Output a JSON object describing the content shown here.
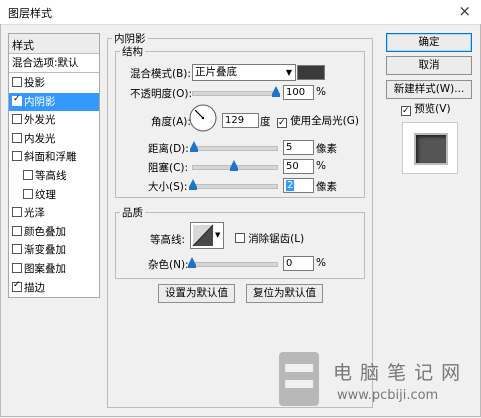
{
  "window": {
    "title": "图层样式",
    "close_glyph": "×"
  },
  "left_panel": {
    "header": "样式",
    "default_item": "混合选项:默认",
    "items": [
      {
        "label": "投影",
        "checked": false,
        "selected": false,
        "indent": false
      },
      {
        "label": "内阴影",
        "checked": true,
        "selected": true,
        "indent": false
      },
      {
        "label": "外发光",
        "checked": false,
        "selected": false,
        "indent": false
      },
      {
        "label": "内发光",
        "checked": false,
        "selected": false,
        "indent": false
      },
      {
        "label": "斜面和浮雕",
        "checked": false,
        "selected": false,
        "indent": false
      },
      {
        "label": "等高线",
        "checked": false,
        "selected": false,
        "indent": true
      },
      {
        "label": "纹理",
        "checked": false,
        "selected": false,
        "indent": true
      },
      {
        "label": "光泽",
        "checked": false,
        "selected": false,
        "indent": false
      },
      {
        "label": "颜色叠加",
        "checked": false,
        "selected": false,
        "indent": false
      },
      {
        "label": "渐变叠加",
        "checked": false,
        "selected": false,
        "indent": false
      },
      {
        "label": "图案叠加",
        "checked": false,
        "selected": false,
        "indent": false
      },
      {
        "label": "描边",
        "checked": true,
        "selected": false,
        "indent": false
      }
    ]
  },
  "inner_shadow": {
    "group_title": "内阴影",
    "structure": {
      "title": "结构",
      "blend_mode_label": "混合模式(B):",
      "blend_mode_value": "正片叠底",
      "opacity_label": "不透明度(O):",
      "opacity_value": "100",
      "opacity_level": 1.0,
      "percent": "%",
      "angle_label": "角度(A):",
      "angle_value": "129",
      "degree_unit": "度",
      "global_light_label": "使用全局光(G)",
      "global_light_checked": true,
      "distance_label": "距离(D):",
      "distance_value": "5",
      "distance_level": 0.02,
      "choke_label": "阻塞(C):",
      "choke_value": "50",
      "choke_level": 0.5,
      "size_label": "大小(S):",
      "size_value": "2",
      "size_level": 0.01,
      "pixel_unit": "像素",
      "shadow_color": "#3a3a3a"
    },
    "quality": {
      "title": "品质",
      "contour_label": "等高线:",
      "antialias_label": "消除锯齿(L)",
      "antialias_checked": false,
      "noise_label": "杂色(N):",
      "noise_value": "0",
      "noise_level": 0.0,
      "percent": "%"
    },
    "buttons": {
      "set_default": "设置为默认值",
      "reset_default": "复位为默认值"
    }
  },
  "right_panel": {
    "ok": "确定",
    "cancel": "取消",
    "new_style": "新建样式(W)...",
    "preview_label": "预览(V)",
    "preview_checked": true
  },
  "watermark": {
    "text_cn": "电 脑 笔 记 网",
    "url": "www.pcbiji.com"
  },
  "colors": {
    "accent": "#3399ff",
    "slider_thumb": "#1e73c7"
  }
}
